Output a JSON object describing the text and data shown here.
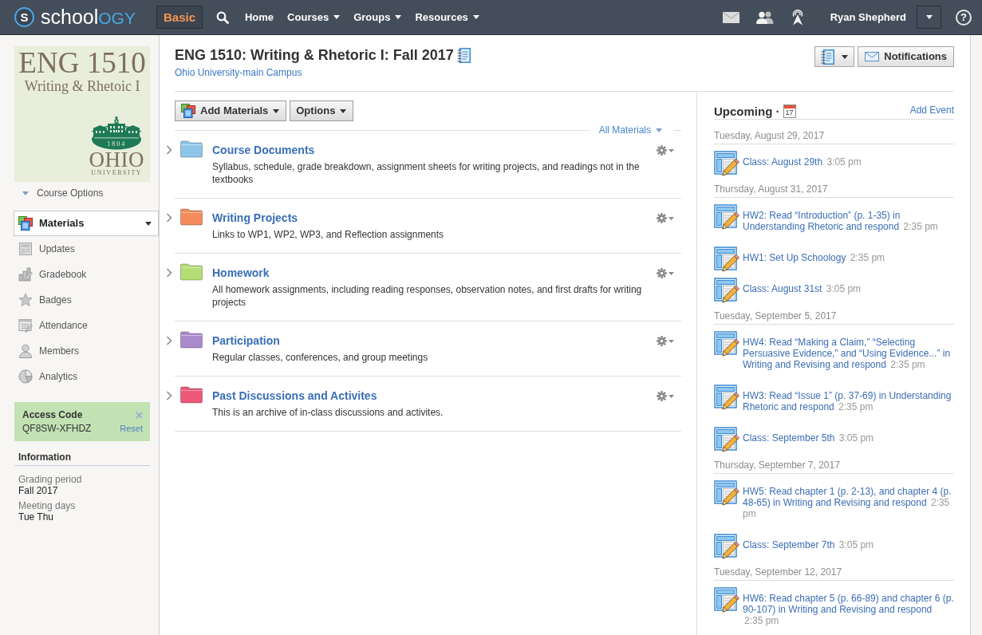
{
  "top_bar": {
    "logo": {
      "mark": "S",
      "text": "school",
      "accent": "OGY"
    },
    "mode_button": "Basic",
    "nav": [
      {
        "label": "Home",
        "dropdown": false
      },
      {
        "label": "Courses",
        "dropdown": true
      },
      {
        "label": "Groups",
        "dropdown": true
      },
      {
        "label": "Resources",
        "dropdown": true
      }
    ],
    "user_name": "Ryan Shepherd",
    "help": "?"
  },
  "sidebar": {
    "course_image": {
      "title": "ENG 1510",
      "subtitle": "Writing & Rhetoic I",
      "emblem_year": "1804",
      "institution": "OHIO",
      "institution_line2": "UNIVERSITY"
    },
    "course_options": "Course Options",
    "nav": [
      {
        "label": "Materials",
        "selected": true
      },
      {
        "label": "Updates",
        "selected": false
      },
      {
        "label": "Gradebook",
        "selected": false
      },
      {
        "label": "Badges",
        "selected": false
      },
      {
        "label": "Attendance",
        "selected": false
      },
      {
        "label": "Members",
        "selected": false
      },
      {
        "label": "Analytics",
        "selected": false
      }
    ],
    "access_code": {
      "title": "Access Code",
      "code": "QF8SW-XFHDZ",
      "reset": "Reset"
    },
    "information": {
      "heading": "Information",
      "fields": [
        {
          "label": "Grading period",
          "value": "Fall 2017"
        },
        {
          "label": "Meeting days",
          "value": "Tue Thu"
        }
      ]
    }
  },
  "course": {
    "title": "ENG 1510: Writing & Rhetoric I: Fall 2017",
    "campus": "Ohio University-main Campus",
    "notifications_button": "Notifications"
  },
  "materials": {
    "buttons": [
      "Add Materials",
      "Options"
    ],
    "filter": "All Materials",
    "folders": [
      {
        "title": "Course Documents",
        "description": "Syllabus, schedule, grade breakdown, assignment sheets for writing projects, and readings not in the textbooks",
        "color": "#8ec6ea"
      },
      {
        "title": "Writing Projects",
        "description": "Links to WP1, WP2, WP3, and Reflection assignments",
        "color": "#f58b5a"
      },
      {
        "title": "Homework",
        "description": "All homework assignments, including reading responses, observation notes, and first drafts for writing projects",
        "color": "#b4de74"
      },
      {
        "title": "Participation",
        "description": "Regular classes, conferences, and group meetings",
        "color": "#a98bcc"
      },
      {
        "title": "Past Discussions and Activites",
        "description": "This is an archive of in-class discussions and activites.",
        "color": "#ee5878"
      }
    ]
  },
  "upcoming": {
    "heading": "Upcoming ·",
    "calendar_day": "17",
    "add_event": "Add Event",
    "days": [
      {
        "date": "Tuesday, August 29, 2017",
        "events": [
          {
            "title": "Class: August 29th",
            "time": "3:05 pm"
          }
        ]
      },
      {
        "date": "Thursday, August 31, 2017",
        "events": [
          {
            "title": "HW2: Read “Introduction” (p. 1-35) in Understanding Rhetoric and respond",
            "time": "2:35 pm"
          },
          {
            "title": "HW1: Set Up Schoology",
            "time": "2:35 pm"
          },
          {
            "title": "Class: August 31st",
            "time": "3:05 pm"
          }
        ]
      },
      {
        "date": "Tuesday, September 5, 2017",
        "events": [
          {
            "title": "HW4: Read “Making a Claim,” “Selecting Persuasive Evidence,” and “Using Evidence...” in Writing and Revising and respond",
            "time": "2:35 pm"
          },
          {
            "title": "HW3: Read “Issue 1” (p. 37-69) in Understanding Rhetoric and respond",
            "time": "2:35 pm"
          },
          {
            "title": "Class: September 5th",
            "time": "3:05 pm"
          }
        ]
      },
      {
        "date": "Thursday, September 7, 2017",
        "events": [
          {
            "title": "HW5: Read chapter 1 (p. 2-13), and chapter 4 (p. 48-65) in Writing and Revising and respond",
            "time": "2:35 pm"
          },
          {
            "title": "Class: September 7th",
            "time": "3:05 pm"
          }
        ]
      },
      {
        "date": "Tuesday, September 12, 2017",
        "events": [
          {
            "title": "HW6: Read chapter 5 (p. 66-89) and chapter 6 (p. 90-107) in Writing and Revising and respond",
            "time": "2:35 pm"
          }
        ]
      }
    ]
  }
}
